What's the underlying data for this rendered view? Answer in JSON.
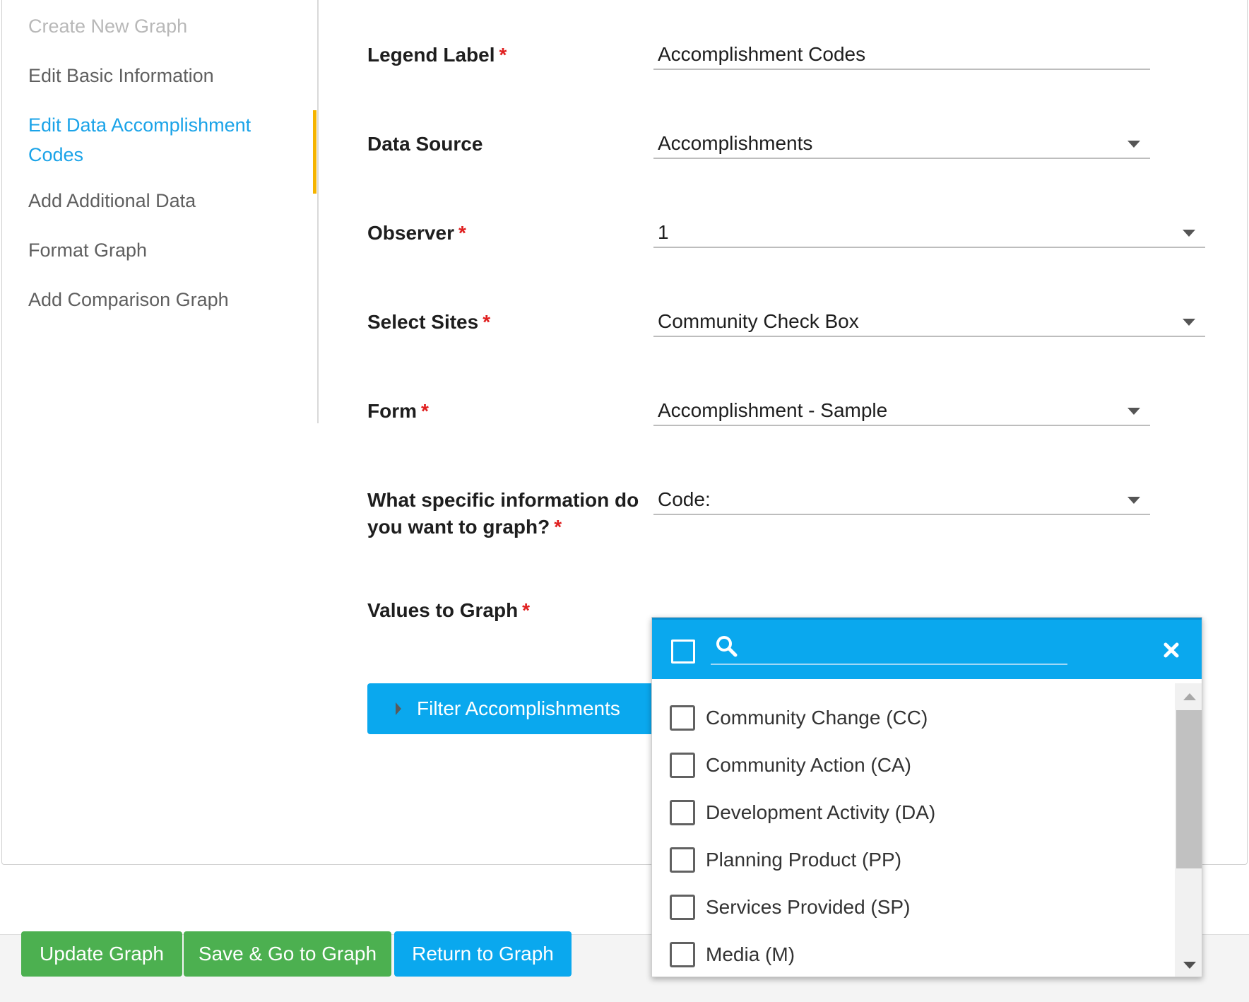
{
  "sidebar": {
    "items": [
      {
        "label": "Create New Graph",
        "state": "disabled"
      },
      {
        "label": "Edit Basic Information",
        "state": "normal"
      },
      {
        "label": "Edit Data Accomplishment Codes",
        "state": "active"
      },
      {
        "label": "Add Additional Data",
        "state": "normal"
      },
      {
        "label": "Format Graph",
        "state": "normal"
      },
      {
        "label": "Add Comparison Graph",
        "state": "normal"
      }
    ]
  },
  "form": {
    "required_marker": "*",
    "legend_label": {
      "label": "Legend Label",
      "value": "Accomplishment Codes"
    },
    "data_source": {
      "label": "Data Source",
      "value": "Accomplishments"
    },
    "observer": {
      "label": "Observer",
      "value": "1"
    },
    "select_sites": {
      "label": "Select Sites",
      "value": "Community Check Box"
    },
    "form_field": {
      "label": "Form",
      "value": "Accomplishment - Sample"
    },
    "specific_info": {
      "label": "What specific information do you want to graph?",
      "value": "Code:"
    },
    "values_to_graph": {
      "label": "Values to Graph"
    }
  },
  "filter_button": {
    "label": "Filter Accomplishments"
  },
  "dropdown": {
    "search_value": "",
    "options": [
      "Community Change (CC)",
      "Community Action (CA)",
      "Development Activity (DA)",
      "Planning Product (PP)",
      "Services Provided (SP)",
      "Media (M)"
    ]
  },
  "footer": {
    "update_label": "Update Graph",
    "save_go_label": "Save & Go to Graph",
    "return_label": "Return to Graph"
  },
  "colors": {
    "accent_blue": "#0aa8ee",
    "active_bar": "#f5b400",
    "green_button": "#4cb050",
    "required": "#e02020"
  }
}
